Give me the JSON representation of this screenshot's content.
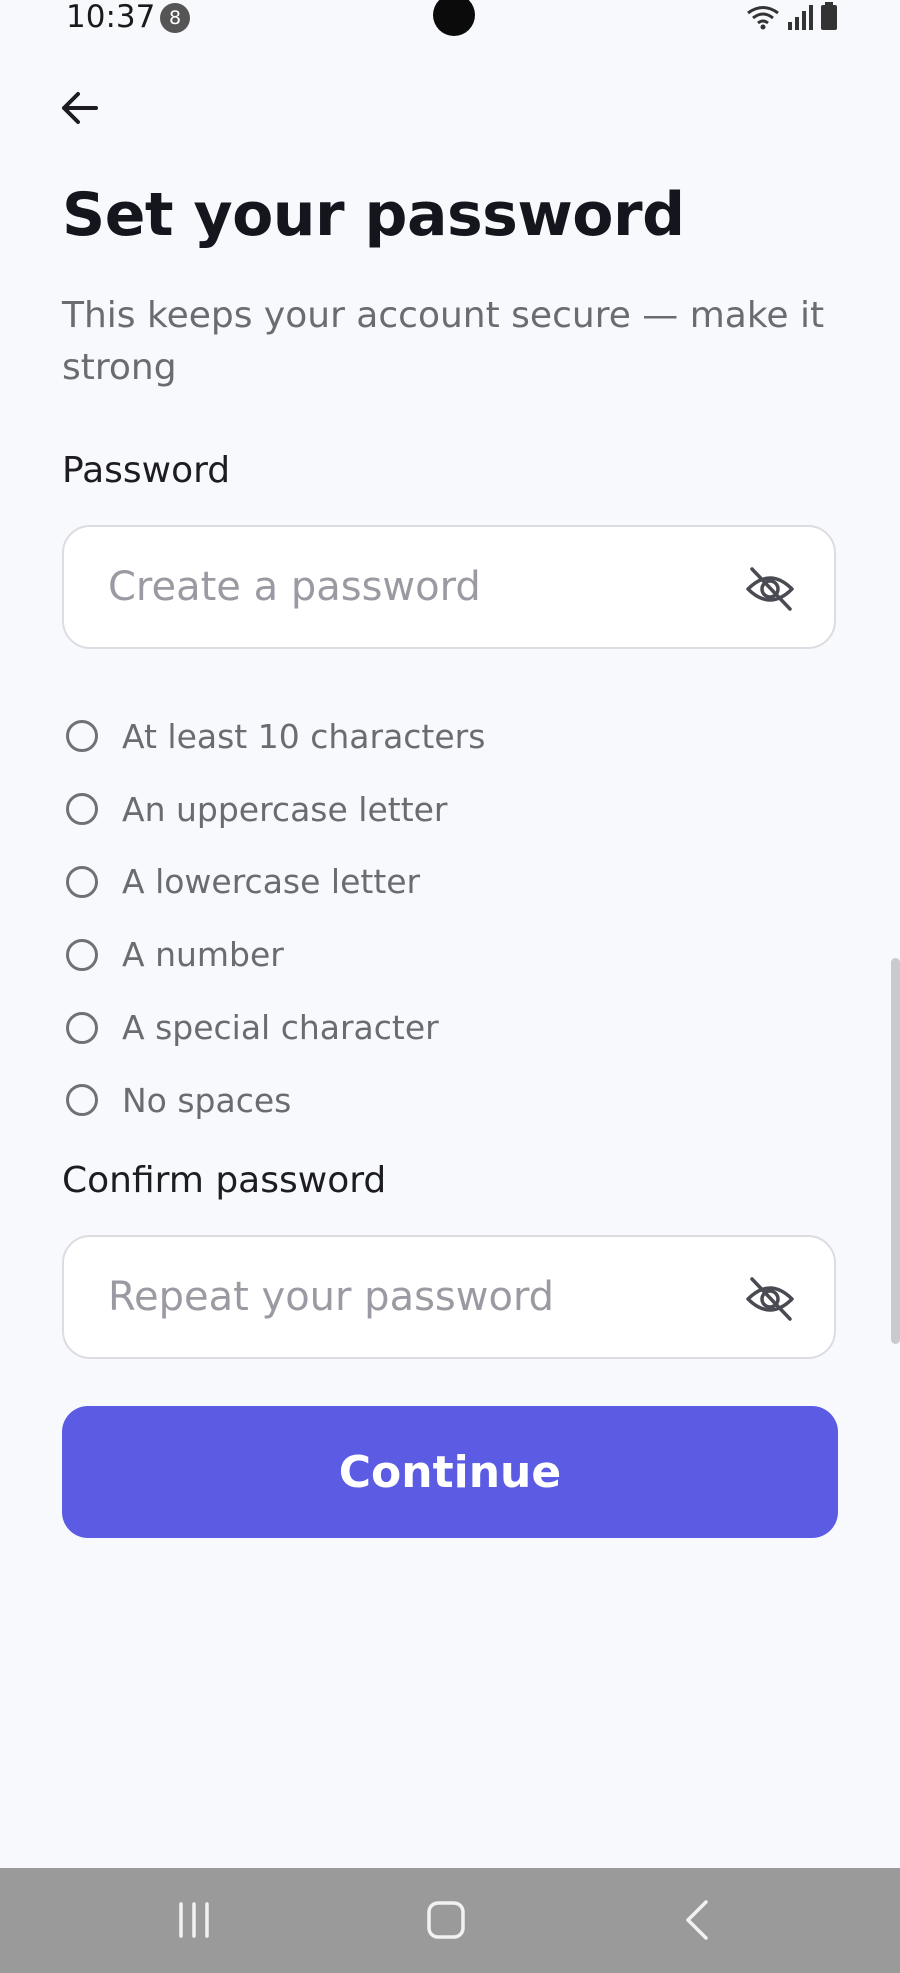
{
  "status_bar": {
    "time": "10:37",
    "notification_count": "8"
  },
  "header": {
    "title": "Set your password",
    "subtitle": "This keeps your account secure — make it strong"
  },
  "password_field": {
    "label": "Password",
    "placeholder": "Create a password",
    "value": ""
  },
  "requirements": [
    {
      "text": "At least 10 characters",
      "met": false
    },
    {
      "text": "An uppercase letter",
      "met": false
    },
    {
      "text": "A lowercase letter",
      "met": false
    },
    {
      "text": "A number",
      "met": false
    },
    {
      "text": "A special character",
      "met": false
    },
    {
      "text": "No spaces",
      "met": false
    }
  ],
  "confirm_field": {
    "label": "Confirm password",
    "placeholder": "Repeat your password",
    "value": ""
  },
  "actions": {
    "continue_label": "Continue"
  },
  "colors": {
    "background": "#f8f9fd",
    "primary": "#5b5be3",
    "title_text": "#15151d",
    "muted_text": "#6b6b72",
    "input_border": "#dcdce2",
    "nav_bar": "#9a9a9a"
  },
  "icons": {
    "back": "arrow-left-icon",
    "visibility": "eye-off-icon",
    "nav_recents": "recents-icon",
    "nav_home": "home-icon",
    "nav_back": "chevron-left-icon"
  }
}
